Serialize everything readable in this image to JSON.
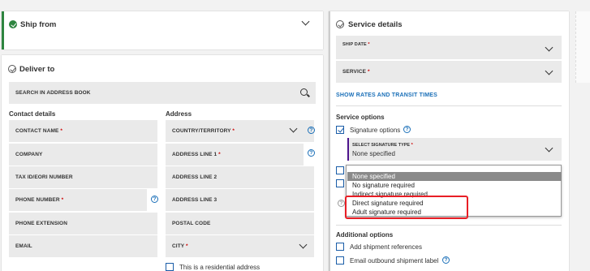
{
  "ship_from": {
    "title": "Ship from"
  },
  "deliver_to": {
    "title": "Deliver to",
    "search_placeholder": "SEARCH IN ADDRESS BOOK",
    "contact_heading": "Contact details",
    "address_heading": "Address",
    "contact_fields": [
      {
        "label": "CONTACT NAME",
        "required": "*"
      },
      {
        "label": "COMPANY"
      },
      {
        "label": "TAX ID/EORI NUMBER"
      },
      {
        "label": "PHONE NUMBER",
        "required": "*"
      },
      {
        "label": "PHONE EXTENSION"
      },
      {
        "label": "EMAIL"
      }
    ],
    "address_fields": [
      {
        "label": "COUNTRY/TERRITORY",
        "required": "*"
      },
      {
        "label": "ADDRESS LINE 1",
        "required": "*"
      },
      {
        "label": "ADDRESS LINE 2"
      },
      {
        "label": "ADDRESS LINE 3"
      },
      {
        "label": "POSTAL CODE"
      },
      {
        "label": "CITY",
        "required": "*"
      }
    ],
    "residential_label": "This is a residential address"
  },
  "service_details": {
    "title": "Service details",
    "ship_date_label": "SHIP DATE",
    "service_label": "SERVICE",
    "required": "*",
    "rates_link": "SHOW RATES AND TRANSIT TIMES",
    "service_options_heading": "Service options",
    "signature_options_label": "Signature options",
    "signature_type_label": "SELECT SIGNATURE TYPE",
    "signature_type_value": "None specified",
    "signature_dropdown_options": [
      "None specified",
      "No signature required",
      "Indirect signature required",
      "Direct signature required",
      "Adult signature required"
    ],
    "additional_options_heading": "Additional options",
    "add_refs_label": "Add shipment references",
    "email_label_label": "Email outbound shipment label"
  },
  "colors": {
    "accent_green": "#2e8540",
    "link_blue": "#1a6fb8",
    "highlight_red": "#e81e25",
    "signature_bar_purple": "#4d148c"
  }
}
